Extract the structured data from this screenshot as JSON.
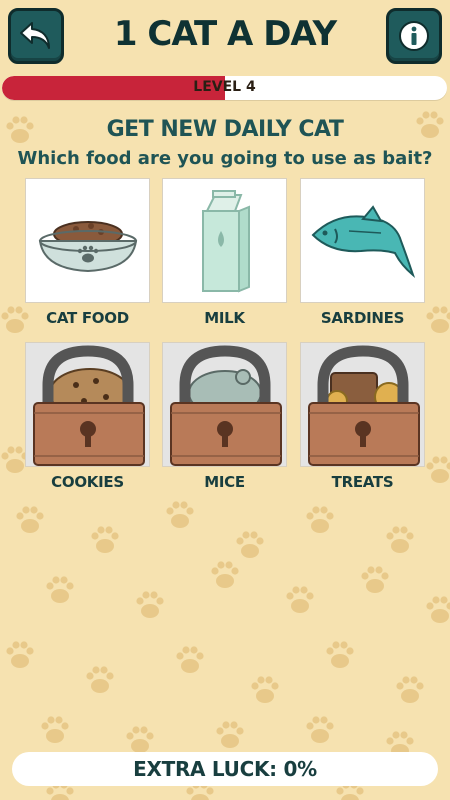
{
  "header": {
    "title": "1 CAT A DAY",
    "back_icon": "back-arrow-icon",
    "info_icon": "info-icon",
    "button_color": "#1f5b5c"
  },
  "level": {
    "label": "LEVEL 4",
    "progress": 0.5,
    "fill_color": "#c8243a"
  },
  "main": {
    "heading": "GET NEW DAILY CAT",
    "question": "Which food are you going to use as bait?"
  },
  "foods": [
    {
      "label": "CAT FOOD",
      "locked": false,
      "icon": "cat-food-bowl-icon"
    },
    {
      "label": "MILK",
      "locked": false,
      "icon": "milk-carton-icon"
    },
    {
      "label": "SARDINES",
      "locked": false,
      "icon": "sardine-fish-icon"
    },
    {
      "label": "COOKIES",
      "locked": true,
      "icon": "cookies-lock-icon"
    },
    {
      "label": "MICE",
      "locked": true,
      "icon": "mice-lock-icon"
    },
    {
      "label": "TREATS",
      "locked": true,
      "icon": "treats-lock-icon"
    }
  ],
  "footer": {
    "extra_luck": "EXTRA LUCK: 0%"
  },
  "colors": {
    "background": "#f6e2b0",
    "paw": "#e8c98a",
    "text_teal": "#1f5455"
  }
}
